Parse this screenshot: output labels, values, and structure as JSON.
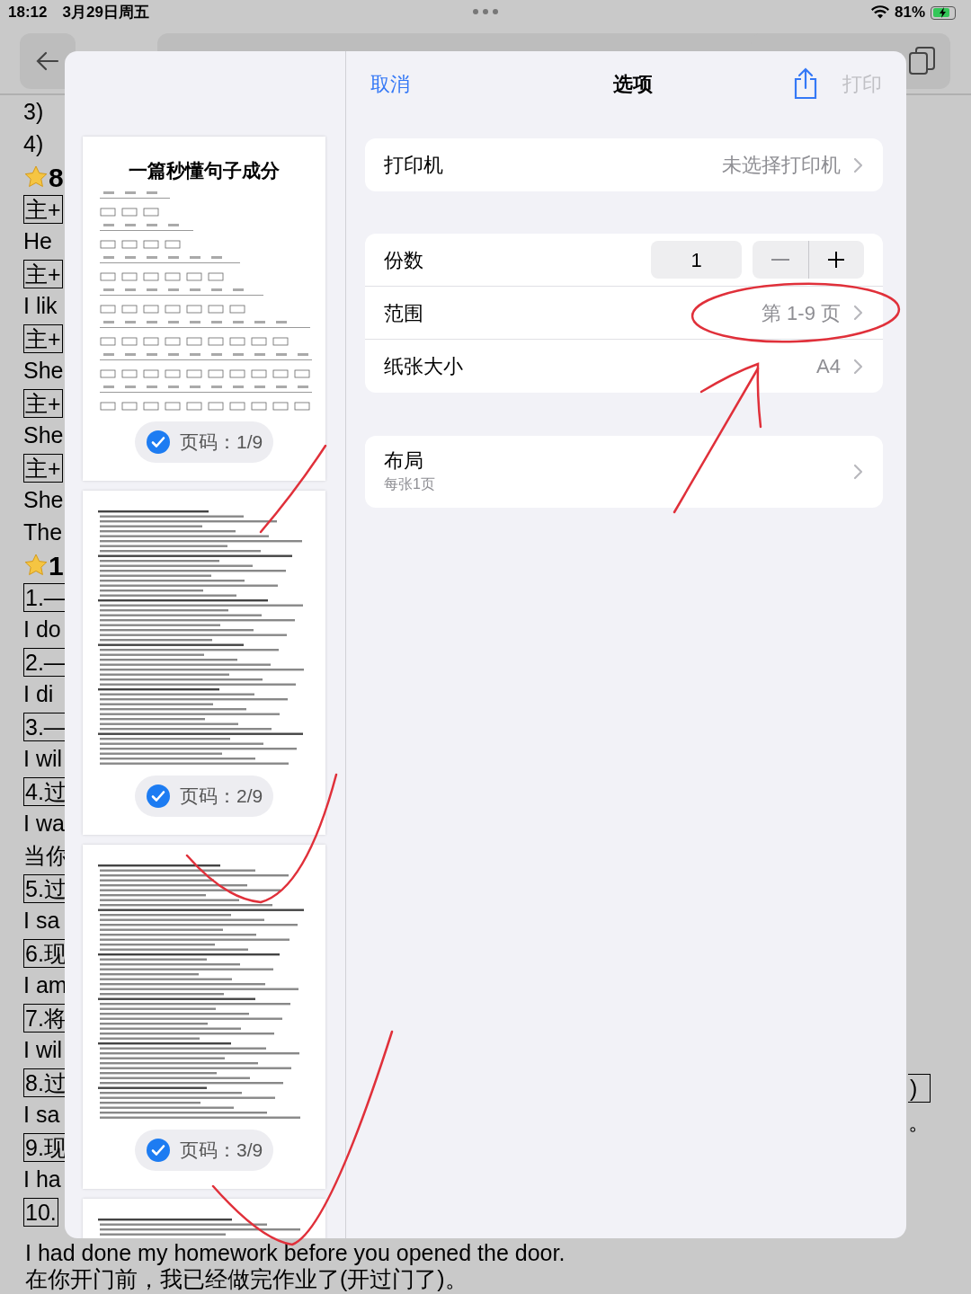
{
  "status_bar": {
    "time": "18:12",
    "date": "3月29日周五",
    "battery": "81%",
    "charging": true
  },
  "background_document": {
    "lines": [
      {
        "kind": "text",
        "text": "3)"
      },
      {
        "kind": "text",
        "text": "4)"
      },
      {
        "kind": "star",
        "text": "8"
      },
      {
        "kind": "boxed",
        "text": "主+"
      },
      {
        "kind": "text",
        "text": "He"
      },
      {
        "kind": "boxed",
        "text": "主+"
      },
      {
        "kind": "text",
        "text": "I lik"
      },
      {
        "kind": "boxed",
        "text": "主+"
      },
      {
        "kind": "text",
        "text": "She"
      },
      {
        "kind": "boxed",
        "text": "主+"
      },
      {
        "kind": "text",
        "text": "She"
      },
      {
        "kind": "boxed",
        "text": "主+"
      },
      {
        "kind": "text",
        "text": "She"
      },
      {
        "kind": "text",
        "text": "The"
      },
      {
        "kind": "star",
        "text": "1"
      },
      {
        "kind": "boxed",
        "text": "1.—"
      },
      {
        "kind": "text",
        "text": "I do"
      },
      {
        "kind": "boxed",
        "text": "2.—"
      },
      {
        "kind": "text",
        "text": "I di"
      },
      {
        "kind": "boxed",
        "text": "3.—"
      },
      {
        "kind": "text",
        "text": "I wil"
      },
      {
        "kind": "boxed",
        "text": "4.过"
      },
      {
        "kind": "text",
        "text": "I wa"
      },
      {
        "kind": "text",
        "text": "当你"
      },
      {
        "kind": "boxed",
        "text": "5.过"
      },
      {
        "kind": "text",
        "text": "I sa"
      },
      {
        "kind": "boxed",
        "text": "6.现"
      },
      {
        "kind": "text",
        "text": "I am"
      },
      {
        "kind": "boxed",
        "text": "7.将"
      },
      {
        "kind": "text",
        "text": "I wil"
      },
      {
        "kind": "boxed",
        "text": "8.过"
      },
      {
        "kind": "text",
        "text": "I sa"
      },
      {
        "kind": "boxed",
        "text": "9.现"
      },
      {
        "kind": "text",
        "text": "I ha"
      },
      {
        "kind": "boxed",
        "text": "10."
      }
    ],
    "bottom_lines": [
      "I had done my homework before you opened the door.",
      "在你开门前，我已经做完作业了(开过门了)。"
    ],
    "right_fragments": [
      {
        "kind": "boxed",
        "text": ")"
      },
      {
        "kind": "text",
        "text": "。"
      }
    ]
  },
  "print_dialog": {
    "cancel": "取消",
    "title": "选项",
    "print": {
      "label": "打印",
      "disabled": true
    },
    "printer": {
      "label": "打印机",
      "value": "未选择打印机"
    },
    "copies": {
      "label": "份数",
      "value": "1"
    },
    "range": {
      "label": "范围",
      "value": "第 1-9 页"
    },
    "paper": {
      "label": "纸张大小",
      "value": "A4"
    },
    "layout": {
      "label": "布局",
      "detail": "每张1页"
    },
    "pages": [
      {
        "kind": "diagram",
        "title": "一篇秒懂句子成分",
        "badge": "页码：1/9",
        "selected": true
      },
      {
        "kind": "text",
        "badge": "页码：2/9",
        "selected": true
      },
      {
        "kind": "text",
        "badge": "页码：3/9",
        "selected": true
      },
      {
        "kind": "text"
      }
    ]
  }
}
